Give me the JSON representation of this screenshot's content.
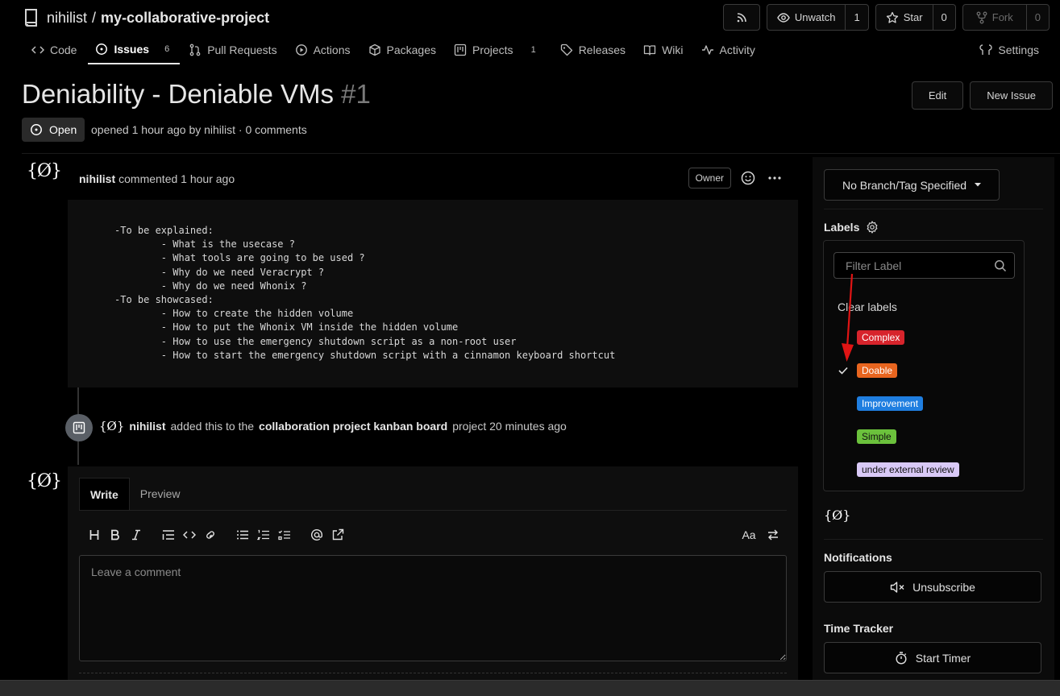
{
  "repo": {
    "owner": "nihilist",
    "separator": "/",
    "name": "my-collaborative-project"
  },
  "repo_actions": {
    "unwatch_label": "Unwatch",
    "unwatch_count": "1",
    "star_label": "Star",
    "star_count": "0",
    "fork_label": "Fork",
    "fork_count": "0"
  },
  "tabs": [
    {
      "label": "Code"
    },
    {
      "label": "Issues",
      "count": "6"
    },
    {
      "label": "Pull Requests"
    },
    {
      "label": "Actions"
    },
    {
      "label": "Packages"
    },
    {
      "label": "Projects",
      "count": "1"
    },
    {
      "label": "Releases"
    },
    {
      "label": "Wiki"
    },
    {
      "label": "Activity"
    }
  ],
  "settings_label": "Settings",
  "issue": {
    "title": "Deniability - Deniable VMs",
    "number": "#1",
    "status": "Open",
    "meta": "opened 1 hour ago by nihilist · 0 comments",
    "edit_label": "Edit",
    "new_issue_label": "New Issue"
  },
  "avatar_text": "{Ø}",
  "comment": {
    "author": "nihilist",
    "action": "commented 1 hour ago",
    "role": "Owner",
    "body": "-To be explained:\n        - What is the usecase ?\n        - What tools are going to be used ?\n        - Why do we need Veracrypt ?\n        - Why do we need Whonix ?\n-To be showcased:\n        - How to create the hidden volume\n        - How to put the Whonix VM inside the hidden volume\n        - How to use the emergency shutdown script as a non-root user\n        - How to start the emergency shutdown script with a cinnamon keyboard shortcut"
  },
  "event": {
    "avatar_text": "{Ø}",
    "author": "nihilist",
    "text_before": "added this to the",
    "project": "collaboration project kanban board",
    "text_after": "project 20 minutes ago"
  },
  "editor": {
    "write_tab": "Write",
    "preview_tab": "Preview",
    "placeholder": "Leave a comment",
    "text_size_label": "Aa"
  },
  "sidebar": {
    "branch_label": "No Branch/Tag Specified",
    "labels_heading": "Labels",
    "filter_placeholder": "Filter Label",
    "clear_labels": "Clear labels",
    "labels": [
      {
        "name": "Complex",
        "color": "#d7242c",
        "text_color": "#ffffff",
        "checked": false
      },
      {
        "name": "Doable",
        "color": "#e8651f",
        "text_color": "#ffffff",
        "checked": true
      },
      {
        "name": "Improvement",
        "color": "#1f7ee0",
        "text_color": "#ffffff",
        "checked": false
      },
      {
        "name": "Simple",
        "color": "#6bc13c",
        "text_color": "#111111",
        "checked": false
      },
      {
        "name": "under external review",
        "color": "#d9c9f7",
        "text_color": "#111111",
        "checked": false
      }
    ],
    "avatar_text": "{Ø}",
    "notifications_heading": "Notifications",
    "unsubscribe_label": "Unsubscribe",
    "time_tracker_heading": "Time Tracker",
    "start_timer_label": "Start Timer"
  },
  "annotation_color": "#e01414"
}
